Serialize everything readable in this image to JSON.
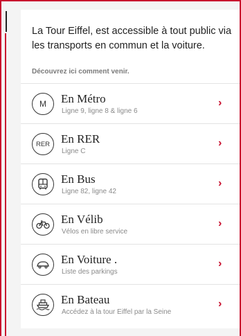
{
  "intro_text": "La Tour Eiffel, est accessible à tout public via les transports en commun et la voiture.",
  "intro_sub": "Découvrez ici comment venir.",
  "accent_color": "#c8102e",
  "items": [
    {
      "icon": "metro-icon",
      "icon_text": "M",
      "title": "En Métro",
      "desc": "Ligne 9, ligne 8 & ligne 6"
    },
    {
      "icon": "rer-icon",
      "icon_text": "RER",
      "title": "En RER",
      "desc": "Ligne C"
    },
    {
      "icon": "bus-icon",
      "title": "En Bus",
      "desc": "Ligne 82, ligne 42"
    },
    {
      "icon": "bike-icon",
      "title": "En Vélib",
      "desc": "Vélos en libre service"
    },
    {
      "icon": "car-icon",
      "title": "En Voiture .",
      "desc": "Liste des parkings"
    },
    {
      "icon": "boat-icon",
      "title": "En Bateau",
      "desc": "Accédez à la tour Eiffel par la Seine"
    }
  ],
  "chevron": "›"
}
